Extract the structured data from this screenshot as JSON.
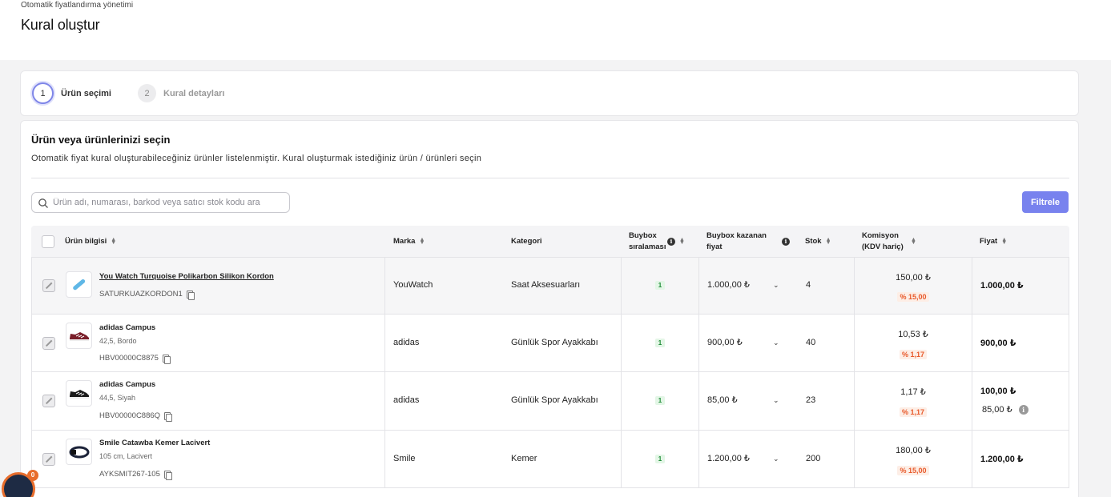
{
  "header": {
    "breadcrumb": "Otomatik fiyatlandırma yönetimi",
    "title": "Kural oluştur"
  },
  "stepper": [
    {
      "number": "1",
      "label": "Ürün seçimi"
    },
    {
      "number": "2",
      "label": "Kural detayları"
    }
  ],
  "card": {
    "title": "Ürün veya ürünlerinizi seçin",
    "description": "Otomatik fiyat kural oluşturabileceğiniz ürünler listelenmiştir. Kural oluşturmak istediğiniz ürün / ürünleri seçin"
  },
  "search": {
    "placeholder": "Ürün adı, numarası, barkod veya satıcı stok kodu ara"
  },
  "filter_label": "Filtrele",
  "columns": {
    "product": "Ürün bilgisi",
    "brand": "Marka",
    "category": "Kategori",
    "buybox_rank_1": "Buybox",
    "buybox_rank_2": "sıralaması",
    "buybox_price_1": "Buybox kazanan",
    "buybox_price_2": "fiyat",
    "stock": "Stok",
    "commission_1": "Komisyon",
    "commission_2": "(KDV hariç)",
    "price": "Fiyat"
  },
  "rows": [
    {
      "name": "You Watch Turquoise Polikarbon Silikon Kordon",
      "sub": "",
      "sku": "SATURKUAZKORDON1",
      "brand": "YouWatch",
      "category": "Saat Aksesuarları",
      "rank": "1",
      "buybox_price": "1.000,00 ₺",
      "stock": "4",
      "commission": "150,00 ₺",
      "commission_pct": "% 15,00",
      "price": "1.000,00 ₺",
      "price2": ""
    },
    {
      "name": "adidas Campus",
      "sub": "42,5, Bordo",
      "sku": "HBV00000C8875",
      "brand": "adidas",
      "category": "Günlük Spor Ayakkabı",
      "rank": "1",
      "buybox_price": "900,00 ₺",
      "stock": "40",
      "commission": "10,53 ₺",
      "commission_pct": "% 1,17",
      "price": "900,00 ₺",
      "price2": ""
    },
    {
      "name": "adidas Campus",
      "sub": "44,5, Siyah",
      "sku": "HBV00000C886Q",
      "brand": "adidas",
      "category": "Günlük Spor Ayakkabı",
      "rank": "1",
      "buybox_price": "85,00 ₺",
      "stock": "23",
      "commission": "1,17 ₺",
      "commission_pct": "% 1,17",
      "price": "100,00 ₺",
      "price2": "85,00 ₺"
    },
    {
      "name": "Smile Catawba Kemer Lacivert",
      "sub": "105 cm, Lacivert",
      "sku": "AYKSMIT267-105",
      "brand": "Smile",
      "category": "Kemer",
      "rank": "1",
      "buybox_price": "1.200,00 ₺",
      "stock": "200",
      "commission": "180,00 ₺",
      "commission_pct": "% 15,00",
      "price": "1.200,00 ₺",
      "price2": ""
    }
  ],
  "avatar_badge": "0"
}
